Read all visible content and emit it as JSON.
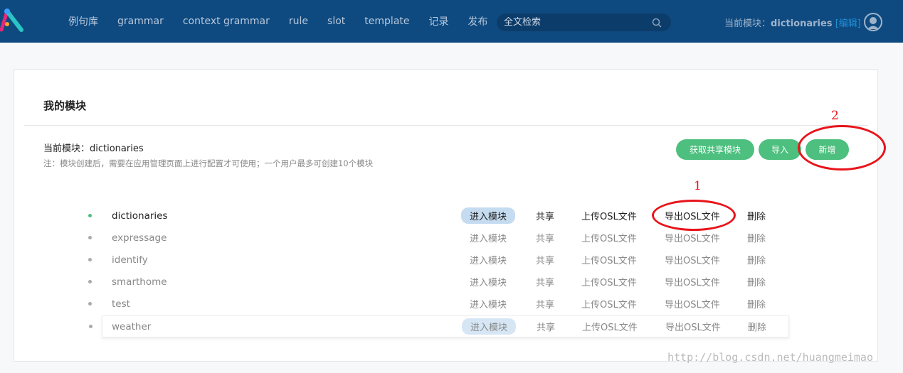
{
  "nav": {
    "menu": [
      "例句库",
      "grammar",
      "context grammar",
      "rule",
      "slot",
      "template",
      "记录",
      "发布"
    ],
    "search_placeholder": "全文检索",
    "current_label": "当前模块：",
    "current_module": "dictionaries",
    "edit": "[编辑]"
  },
  "page": {
    "title": "我的模块",
    "current": "当前模块：dictionaries",
    "note": "注：模块创建后，需要在应用管理页面上进行配置才可使用；一个用户最多可创建10个模块",
    "buttons": {
      "get_shared": "获取共享模块",
      "import": "导入",
      "add": "新增"
    }
  },
  "actions": {
    "enter": "进入模块",
    "share": "共享",
    "upload": "上传OSL文件",
    "export": "导出OSL文件",
    "delete": "删除"
  },
  "modules": [
    {
      "name": "dictionaries",
      "state": "active"
    },
    {
      "name": "expressage"
    },
    {
      "name": "identify"
    },
    {
      "name": "smarthome"
    },
    {
      "name": "test"
    },
    {
      "name": "weather",
      "state": "hover"
    }
  ],
  "annotations": {
    "one": "1",
    "two": "2",
    "accent": "#e8141b"
  },
  "watermark": "http://blog.csdn.net/huangmeimao",
  "colors": {
    "nav": "#0e4a80",
    "green": "#4dbf7e",
    "link": "#1f8fd6"
  }
}
